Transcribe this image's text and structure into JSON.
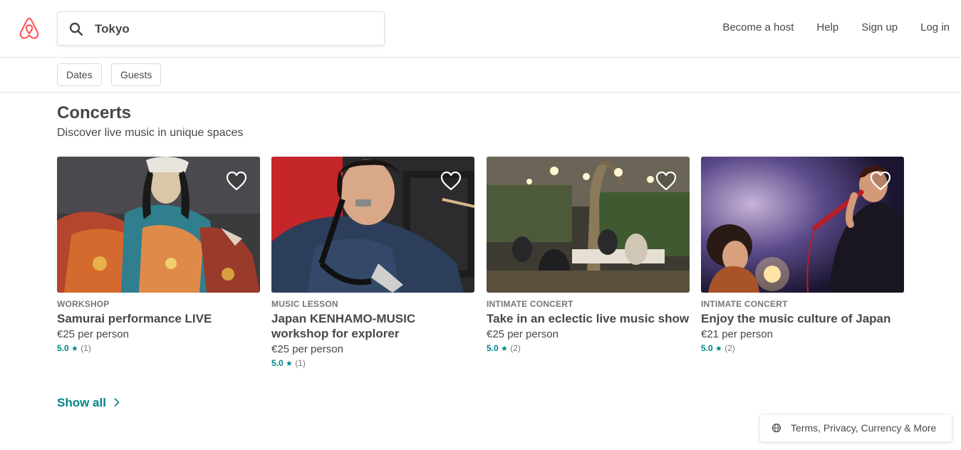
{
  "header": {
    "logo": "airbnb-logo",
    "search": {
      "value": "Tokyo",
      "icon": "search-icon"
    },
    "nav": [
      {
        "label": "Become a host"
      },
      {
        "label": "Help"
      },
      {
        "label": "Sign up"
      },
      {
        "label": "Log in"
      }
    ]
  },
  "filters": [
    {
      "label": "Dates"
    },
    {
      "label": "Guests"
    }
  ],
  "section": {
    "title": "Concerts",
    "subtitle": "Discover live music in unique spaces"
  },
  "cards": [
    {
      "kicker": "WORKSHOP",
      "title": "Samurai performance LIVE",
      "price": "€25 per person",
      "rating": "5.0",
      "star": "★",
      "count": "(1)"
    },
    {
      "kicker": "MUSIC LESSON",
      "title": "Japan KENHAMO-MUSIC workshop for explorer",
      "price": "€25 per person",
      "rating": "5.0",
      "star": "★",
      "count": "(1)"
    },
    {
      "kicker": "INTIMATE CONCERT",
      "title": "Take in an eclectic live music show",
      "price": "€25 per person",
      "rating": "5.0",
      "star": "★",
      "count": "(2)"
    },
    {
      "kicker": "INTIMATE CONCERT",
      "title": "Enjoy the music culture of Japan",
      "price": "€21 per person",
      "rating": "5.0",
      "star": "★",
      "count": "(2)"
    }
  ],
  "show_all": {
    "label": "Show all"
  },
  "footer": {
    "label": "Terms, Privacy, Currency & More",
    "icon": "globe-icon"
  },
  "colors": {
    "brand": "#FF5A5F",
    "accent": "#008489",
    "text": "#484848",
    "muted": "#767676"
  }
}
